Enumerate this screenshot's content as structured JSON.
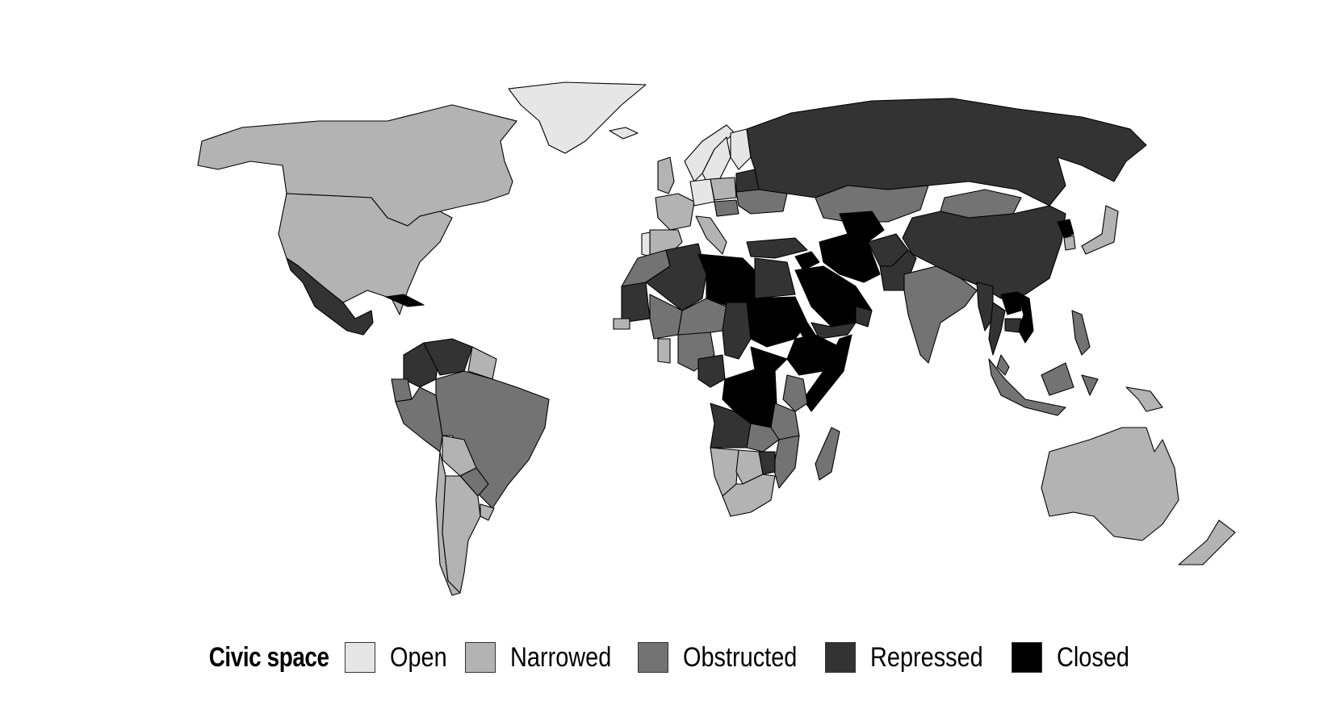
{
  "chart_data": {
    "type": "choropleth",
    "title": "",
    "legend": {
      "title": "Civic space",
      "placement": "bottom-center",
      "categories": [
        {
          "key": "open",
          "label": "Open",
          "color": "#e6e6e6"
        },
        {
          "key": "narrowed",
          "label": "Narrowed",
          "color": "#b3b3b3"
        },
        {
          "key": "obstructed",
          "label": "Obstructed",
          "color": "#737373"
        },
        {
          "key": "repressed",
          "label": "Repressed",
          "color": "#333333"
        },
        {
          "key": "closed",
          "label": "Closed",
          "color": "#000000"
        }
      ]
    },
    "regions": [
      {
        "name": "Greenland",
        "category": "open"
      },
      {
        "name": "Iceland",
        "category": "open"
      },
      {
        "name": "Norway",
        "category": "open"
      },
      {
        "name": "Sweden",
        "category": "open"
      },
      {
        "name": "Finland",
        "category": "open"
      },
      {
        "name": "Germany",
        "category": "open"
      },
      {
        "name": "Portugal",
        "category": "open"
      },
      {
        "name": "Canada",
        "category": "narrowed"
      },
      {
        "name": "United States",
        "category": "narrowed"
      },
      {
        "name": "United Kingdom",
        "category": "narrowed"
      },
      {
        "name": "France",
        "category": "narrowed"
      },
      {
        "name": "Spain",
        "category": "narrowed"
      },
      {
        "name": "Italy",
        "category": "narrowed"
      },
      {
        "name": "Poland",
        "category": "narrowed"
      },
      {
        "name": "Japan",
        "category": "narrowed"
      },
      {
        "name": "South Korea",
        "category": "narrowed"
      },
      {
        "name": "Australia",
        "category": "narrowed"
      },
      {
        "name": "New Zealand",
        "category": "narrowed"
      },
      {
        "name": "Argentina",
        "category": "narrowed"
      },
      {
        "name": "Chile",
        "category": "narrowed"
      },
      {
        "name": "Bolivia",
        "category": "narrowed"
      },
      {
        "name": "Uruguay",
        "category": "narrowed"
      },
      {
        "name": "Guyana",
        "category": "narrowed"
      },
      {
        "name": "Suriname",
        "category": "narrowed"
      },
      {
        "name": "Namibia",
        "category": "narrowed"
      },
      {
        "name": "Botswana",
        "category": "narrowed"
      },
      {
        "name": "South Africa",
        "category": "narrowed"
      },
      {
        "name": "Ghana",
        "category": "narrowed"
      },
      {
        "name": "Senegal",
        "category": "narrowed"
      },
      {
        "name": "Papua New Guinea",
        "category": "narrowed"
      },
      {
        "name": "Brazil",
        "category": "obstructed"
      },
      {
        "name": "Peru",
        "category": "obstructed"
      },
      {
        "name": "Ecuador",
        "category": "obstructed"
      },
      {
        "name": "Paraguay",
        "category": "obstructed"
      },
      {
        "name": "Ukraine",
        "category": "obstructed"
      },
      {
        "name": "Hungary",
        "category": "obstructed"
      },
      {
        "name": "Kazakhstan",
        "category": "obstructed"
      },
      {
        "name": "Mongolia",
        "category": "obstructed"
      },
      {
        "name": "India",
        "category": "obstructed"
      },
      {
        "name": "Indonesia",
        "category": "obstructed"
      },
      {
        "name": "Philippines",
        "category": "obstructed"
      },
      {
        "name": "Malaysia",
        "category": "obstructed"
      },
      {
        "name": "Morocco",
        "category": "obstructed"
      },
      {
        "name": "Mali",
        "category": "obstructed"
      },
      {
        "name": "Niger",
        "category": "obstructed"
      },
      {
        "name": "Nigeria",
        "category": "obstructed"
      },
      {
        "name": "Kenya",
        "category": "obstructed"
      },
      {
        "name": "Tanzania",
        "category": "obstructed"
      },
      {
        "name": "Zambia",
        "category": "obstructed"
      },
      {
        "name": "Mozambique",
        "category": "obstructed"
      },
      {
        "name": "Madagascar",
        "category": "obstructed"
      },
      {
        "name": "Russia",
        "category": "repressed"
      },
      {
        "name": "China",
        "category": "repressed"
      },
      {
        "name": "Turkey",
        "category": "repressed"
      },
      {
        "name": "Belarus",
        "category": "repressed"
      },
      {
        "name": "Afghanistan",
        "category": "repressed"
      },
      {
        "name": "Pakistan",
        "category": "repressed"
      },
      {
        "name": "Myanmar",
        "category": "repressed"
      },
      {
        "name": "Thailand",
        "category": "repressed"
      },
      {
        "name": "Cambodia",
        "category": "repressed"
      },
      {
        "name": "Mexico",
        "category": "repressed"
      },
      {
        "name": "Colombia",
        "category": "repressed"
      },
      {
        "name": "Venezuela",
        "category": "repressed"
      },
      {
        "name": "Algeria",
        "category": "repressed"
      },
      {
        "name": "Mauritania",
        "category": "repressed"
      },
      {
        "name": "Chad",
        "category": "repressed"
      },
      {
        "name": "Egypt",
        "category": "repressed"
      },
      {
        "name": "Cameroon",
        "category": "repressed"
      },
      {
        "name": "Angola",
        "category": "repressed"
      },
      {
        "name": "Zimbabwe",
        "category": "repressed"
      },
      {
        "name": "Yemen",
        "category": "repressed"
      },
      {
        "name": "Oman",
        "category": "repressed"
      },
      {
        "name": "Libya",
        "category": "closed"
      },
      {
        "name": "Sudan",
        "category": "closed"
      },
      {
        "name": "Ethiopia",
        "category": "closed"
      },
      {
        "name": "Eritrea",
        "category": "closed"
      },
      {
        "name": "Somalia",
        "category": "closed"
      },
      {
        "name": "DR Congo",
        "category": "closed"
      },
      {
        "name": "South Sudan",
        "category": "closed"
      },
      {
        "name": "Saudi Arabia",
        "category": "closed"
      },
      {
        "name": "Iran",
        "category": "closed"
      },
      {
        "name": "Turkmenistan",
        "category": "closed"
      },
      {
        "name": "Syria",
        "category": "closed"
      },
      {
        "name": "North Korea",
        "category": "closed"
      },
      {
        "name": "Laos",
        "category": "closed"
      },
      {
        "name": "Vietnam",
        "category": "closed"
      },
      {
        "name": "Cuba",
        "category": "closed"
      }
    ]
  }
}
